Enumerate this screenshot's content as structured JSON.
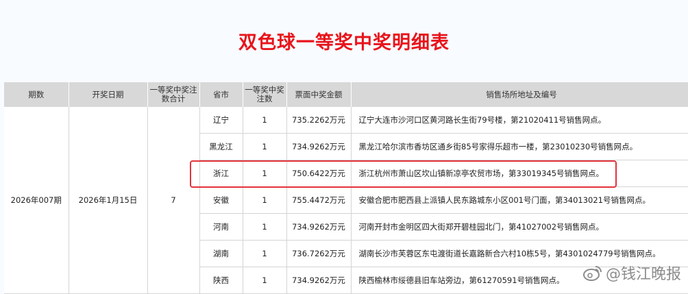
{
  "title": "双色球一等奖中奖明细表",
  "headers": {
    "period": "期数",
    "date": "开奖日期",
    "total": "一等奖中奖注数合计",
    "province": "省市",
    "count": "一等奖中奖注数",
    "amount": "票面中奖金额",
    "address": "销售场所地址及编号"
  },
  "draw": {
    "period": "2026年007期",
    "date": "2026年1月15日",
    "total": "7"
  },
  "rows": [
    {
      "province": "辽宁",
      "count": "1",
      "amount": "735.2262万元",
      "address": "辽宁大连市沙河口区黄河路长生街79号楼，第21020411号销售网点。"
    },
    {
      "province": "黑龙江",
      "count": "1",
      "amount": "734.9262万元",
      "address": "黑龙江哈尔滨市香坊区通乡街85号家得乐超市一楼，第23010230号销售网点。"
    },
    {
      "province": "浙江",
      "count": "1",
      "amount": "750.6422万元",
      "address": "浙江杭州市萧山区坎山镇新凉亭农贸市场，第33019345号销售网点。"
    },
    {
      "province": "安徽",
      "count": "1",
      "amount": "755.4472万元",
      "address": "安徽合肥市肥西县上派镇人民东路城东小区001号门面，第34013021号销售网点。"
    },
    {
      "province": "河南",
      "count": "1",
      "amount": "734.9262万元",
      "address": "河南开封市金明区四大街郑开碧桂园北门，第41027002号销售网点。"
    },
    {
      "province": "湖南",
      "count": "1",
      "amount": "736.7262万元",
      "address": "湖南长沙市芙蓉区东屯渡街道长嘉路新合六村10栋5号，第4301024779号销售网点。"
    },
    {
      "province": "陕西",
      "count": "1",
      "amount": "734.9262万元",
      "address": "陕西榆林市绥德县旧车站旁边，第61270591号销售网点。"
    }
  ],
  "watermark": {
    "text": "@钱江晚报",
    "icon": "weibo-icon"
  },
  "colors": {
    "title": "#e8141b",
    "header_bg": "#d8d8d8",
    "highlight": "#e3323b"
  }
}
